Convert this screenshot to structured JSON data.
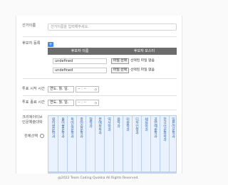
{
  "election_name": {
    "label": "선거이름",
    "placeholder": "선거이름을 입력해주세요."
  },
  "candidates": {
    "label": "후보자 등록",
    "add_label": "+",
    "col_name": "후보자 이름",
    "col_poster": "후보자 포스터",
    "rows": [
      {
        "name": "undefined",
        "file_button": "파일 선택",
        "file_status": "선택된 파일 없음"
      },
      {
        "name": "undefined",
        "file_button": "파일 선택",
        "file_status": "선택된 파일 없음"
      }
    ]
  },
  "vote_start": {
    "label": "투표 시작 시간",
    "date": "연도. 월. 일.",
    "time": "-- : --"
  },
  "vote_end": {
    "label": "투표 종료 시간",
    "date": "연도. 월. 일.",
    "time": "-- : --"
  },
  "voters": {
    "label_line1": "크리에이티브",
    "label_line2": "인문예술대학",
    "select_all": "전체선택",
    "departments": [
      "영어영문학과",
      "불어불문학과",
      "독어독문학과",
      "중어중문학과",
      "철학과",
      "문예창작과",
      "역사학과",
      "음악과",
      "미술학과",
      "디자인학과",
      "체육학과",
      "공연예술학과",
      "한국어문화학과",
      "일본어문학과"
    ]
  },
  "footer": "@2022 Team Coding Quokka All Rights Reserved."
}
